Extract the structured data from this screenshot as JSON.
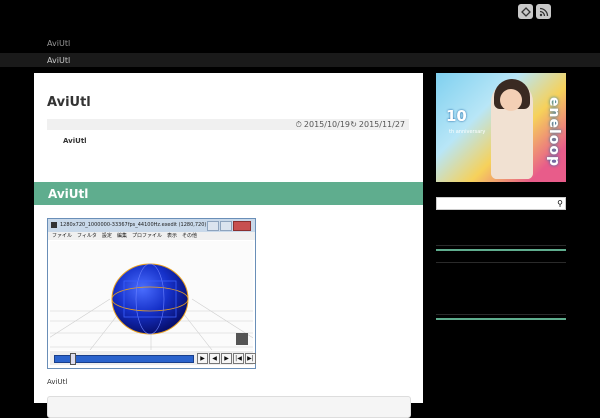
{
  "header": {
    "site_title": "AviUtl",
    "breadcrumb": "AviUtl",
    "social_icons": [
      "feedly-icon",
      "rss-icon"
    ]
  },
  "post": {
    "title": "AviUtl",
    "date_posted": "2015/10/19",
    "date_updated": "2015/11/27",
    "toc_link": "AviUtl",
    "section_heading": "AviUtl",
    "caption": "AviUtl"
  },
  "screenshot_window": {
    "title": "1280x720_1000000-33367fps_44100Hz.exedit (1280,720)  [1...",
    "menu": [
      "ファイル",
      "フィルタ",
      "設定",
      "編集",
      "プロファイル",
      "表示",
      "その他"
    ],
    "seek_buttons": [
      "▶",
      "◀",
      "▶",
      "|◀",
      "▶|"
    ]
  },
  "sidebar": {
    "ad_brand": "eneloop",
    "ad_anniversary": "10",
    "ad_sub": "th anniversary",
    "search_placeholder": ""
  },
  "colors": {
    "accent": "#5fad8e",
    "background": "#000000",
    "content": "#ffffff"
  }
}
